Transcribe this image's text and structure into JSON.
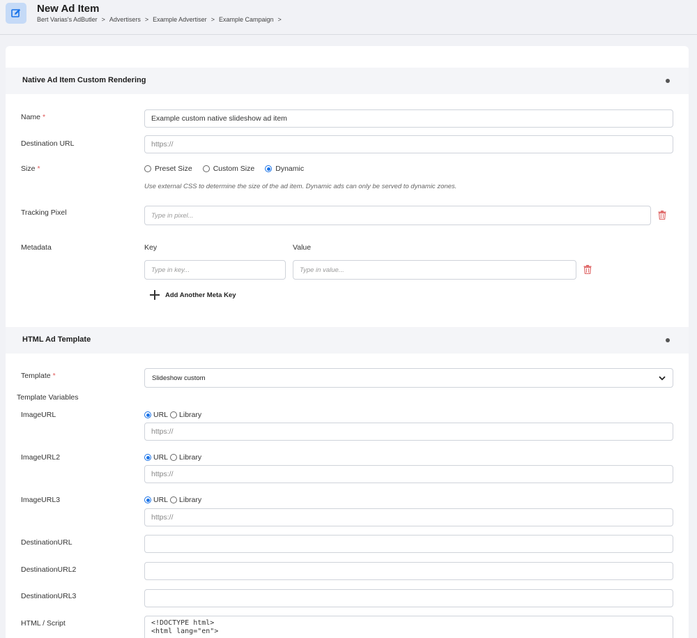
{
  "header": {
    "title": "New Ad Item",
    "breadcrumb": [
      "Bert Varias's AdButler",
      "Advertisers",
      "Example Advertiser",
      "Example Campaign"
    ],
    "breadcrumb_separator": ">",
    "icon": "edit-icon"
  },
  "section_native": {
    "title": "Native Ad Item Custom Rendering",
    "name_label": "Name",
    "name_value": "Example custom native slideshow ad item",
    "destination_label": "Destination URL",
    "destination_placeholder": "https://",
    "size_label": "Size",
    "size_options": [
      "Preset Size",
      "Custom Size",
      "Dynamic"
    ],
    "size_selected": "Dynamic",
    "size_hint": "Use external CSS to determine the size of the ad item. Dynamic ads can only be served to dynamic zones.",
    "tracking_label": "Tracking Pixel",
    "tracking_placeholder": "Type in pixel...",
    "metadata_label": "Metadata",
    "key_label": "Key",
    "value_label": "Value",
    "key_placeholder": "Type in key...",
    "value_placeholder": "Type in value...",
    "add_meta_label": "Add Another Meta Key"
  },
  "section_template": {
    "title": "HTML Ad Template",
    "template_label": "Template",
    "template_value": "Slideshow custom",
    "variables_label": "Template Variables",
    "image_fields": [
      {
        "label": "ImageURL",
        "placeholder": "https://"
      },
      {
        "label": "ImageURL2",
        "placeholder": "https://"
      },
      {
        "label": "ImageURL3",
        "placeholder": "https://"
      }
    ],
    "source_options": [
      "URL",
      "Library"
    ],
    "source_selected": "URL",
    "destination_fields": [
      "DestinationURL",
      "DestinationURL2",
      "DestinationURL3"
    ],
    "html_label": "HTML / Script",
    "code_lines": [
      "<!DOCTYPE html>",
      "<html lang=\"en\">"
    ]
  },
  "colors": {
    "accent": "#1a73e8",
    "required": "#e05a5a",
    "delete": "#e06b6b"
  }
}
